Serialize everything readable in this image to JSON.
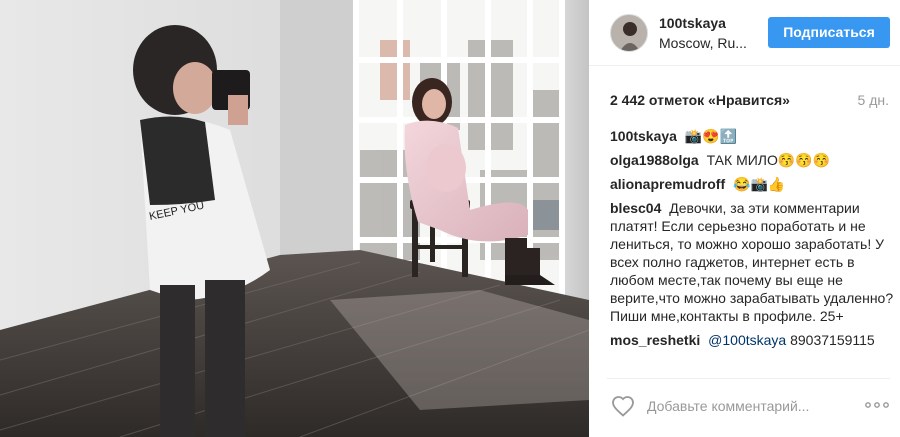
{
  "post": {
    "photo_icon": "photo",
    "header": {
      "username": "100tskaya",
      "location": "Moscow, Ru...",
      "follow_label": "Подписаться"
    },
    "likes_text": "2 442 отметок «Нравится»",
    "time_ago": "5 дн.",
    "comments": [
      {
        "user": "100tskaya",
        "text": "📸😍🔝"
      },
      {
        "user": "olga1988olga",
        "text": "ТАК МИЛО😚😚😚"
      },
      {
        "user": "alionapremudroff",
        "text": "😂📸👍"
      },
      {
        "user": "blesc04",
        "text": "Девочки, за эти комментарии платят! Если серьезно поработать и не лениться, то можно хорошо заработать! У всех полно гаджетов, интернет есть в любом месте,так почему вы еще не верите,что можно зарабатывать удаленно? Пиши мне,контакты в профиле. 25+"
      },
      {
        "user": "mos_reshetki",
        "mention": "@100tskaya",
        "text": "89037159115"
      }
    ],
    "footer": {
      "comment_placeholder": "Добавьте комментарий...",
      "like_icon": "heart-outline",
      "more_icon": "ellipsis"
    }
  },
  "colors": {
    "accent": "#3897f0",
    "text": "#262626",
    "muted": "#999999",
    "mention": "#003569"
  }
}
